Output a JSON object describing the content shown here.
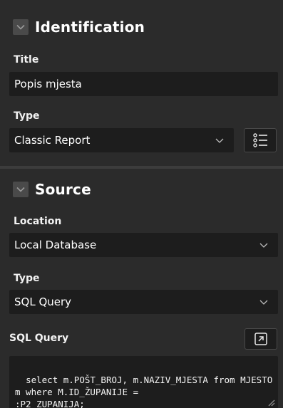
{
  "identification": {
    "title": "Identification",
    "collapse_icon": "chevron-down-icon",
    "title_label": "Title",
    "title_value": "Popis mjesta",
    "type_label": "Type",
    "type_value": "Classic Report",
    "switch_icon": "list-icon"
  },
  "source": {
    "title": "Source",
    "collapse_icon": "chevron-down-icon",
    "location_label": "Location",
    "location_value": "Local Database",
    "type_label": "Type",
    "type_value": "SQL Query",
    "sql_label": "SQL Query",
    "sql_value": "select m.POŠT_BROJ, m.NAZIV_MJESTA from MJESTO m where M.ID_ŽUPANIJE =\n:P2_ZUPANIJA;",
    "expand_icon": "expand-icon"
  },
  "colors": {
    "background": "#2b2b2b",
    "field": "#1d1d1d",
    "divider": "#3c3c3c",
    "button": "#4a4a4a"
  }
}
